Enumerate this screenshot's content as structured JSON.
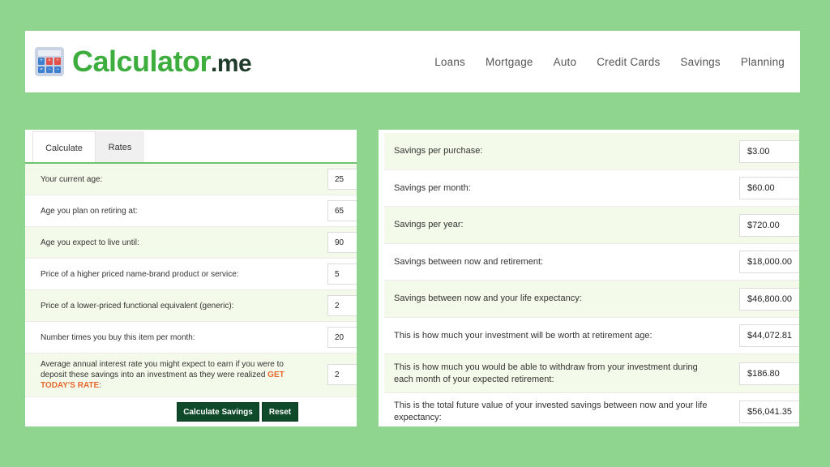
{
  "header": {
    "logo_main": "Calculator",
    "logo_suffix": ".me",
    "nav": [
      "Loans",
      "Mortgage",
      "Auto",
      "Credit Cards",
      "Savings",
      "Planning"
    ]
  },
  "tabs": {
    "calculate": "Calculate",
    "rates": "Rates"
  },
  "form": {
    "rows": [
      {
        "label": "Your current age:",
        "value": "25"
      },
      {
        "label": "Age you plan on retiring at:",
        "value": "65"
      },
      {
        "label": "Age you expect to live until:",
        "value": "90"
      },
      {
        "label": "Price of a higher priced name-brand product or service:",
        "value": "5"
      },
      {
        "label": "Price of a lower-priced functional equivalent (generic):",
        "value": "2"
      },
      {
        "label": "Number times you buy this item per month:",
        "value": "20"
      }
    ],
    "interest": {
      "label": "Average annual interest rate you might expect to earn if you were to deposit these savings into an investment as they were realized",
      "link": "GET TODAY'S RATE",
      "suffix": ":",
      "value": "2"
    },
    "calculate_button": "Calculate Savings",
    "reset_button": "Reset"
  },
  "results": [
    {
      "label": "Savings per purchase:",
      "value": "$3.00"
    },
    {
      "label": "Savings per month:",
      "value": "$60.00"
    },
    {
      "label": "Savings per year:",
      "value": "$720.00"
    },
    {
      "label": "Savings between now and retirement:",
      "value": "$18,000.00"
    },
    {
      "label": "Savings between now and your life expectancy:",
      "value": "$46,800.00"
    },
    {
      "label": "This is how much your investment will be worth at retirement age:",
      "value": "$44,072.81"
    },
    {
      "label": "This is how much you would be able to withdraw from your investment during each month of your expected retirement:",
      "value": "$186.80"
    },
    {
      "label": "This is the total future value of your invested savings between now and your life expectancy:",
      "value": "$56,041.35"
    }
  ],
  "colors": {
    "background": "#8fd48f",
    "logo_green": "#3dae3d",
    "button": "#0f4a2a",
    "link": "#e8672e",
    "row_alt": "#f3fae9"
  }
}
